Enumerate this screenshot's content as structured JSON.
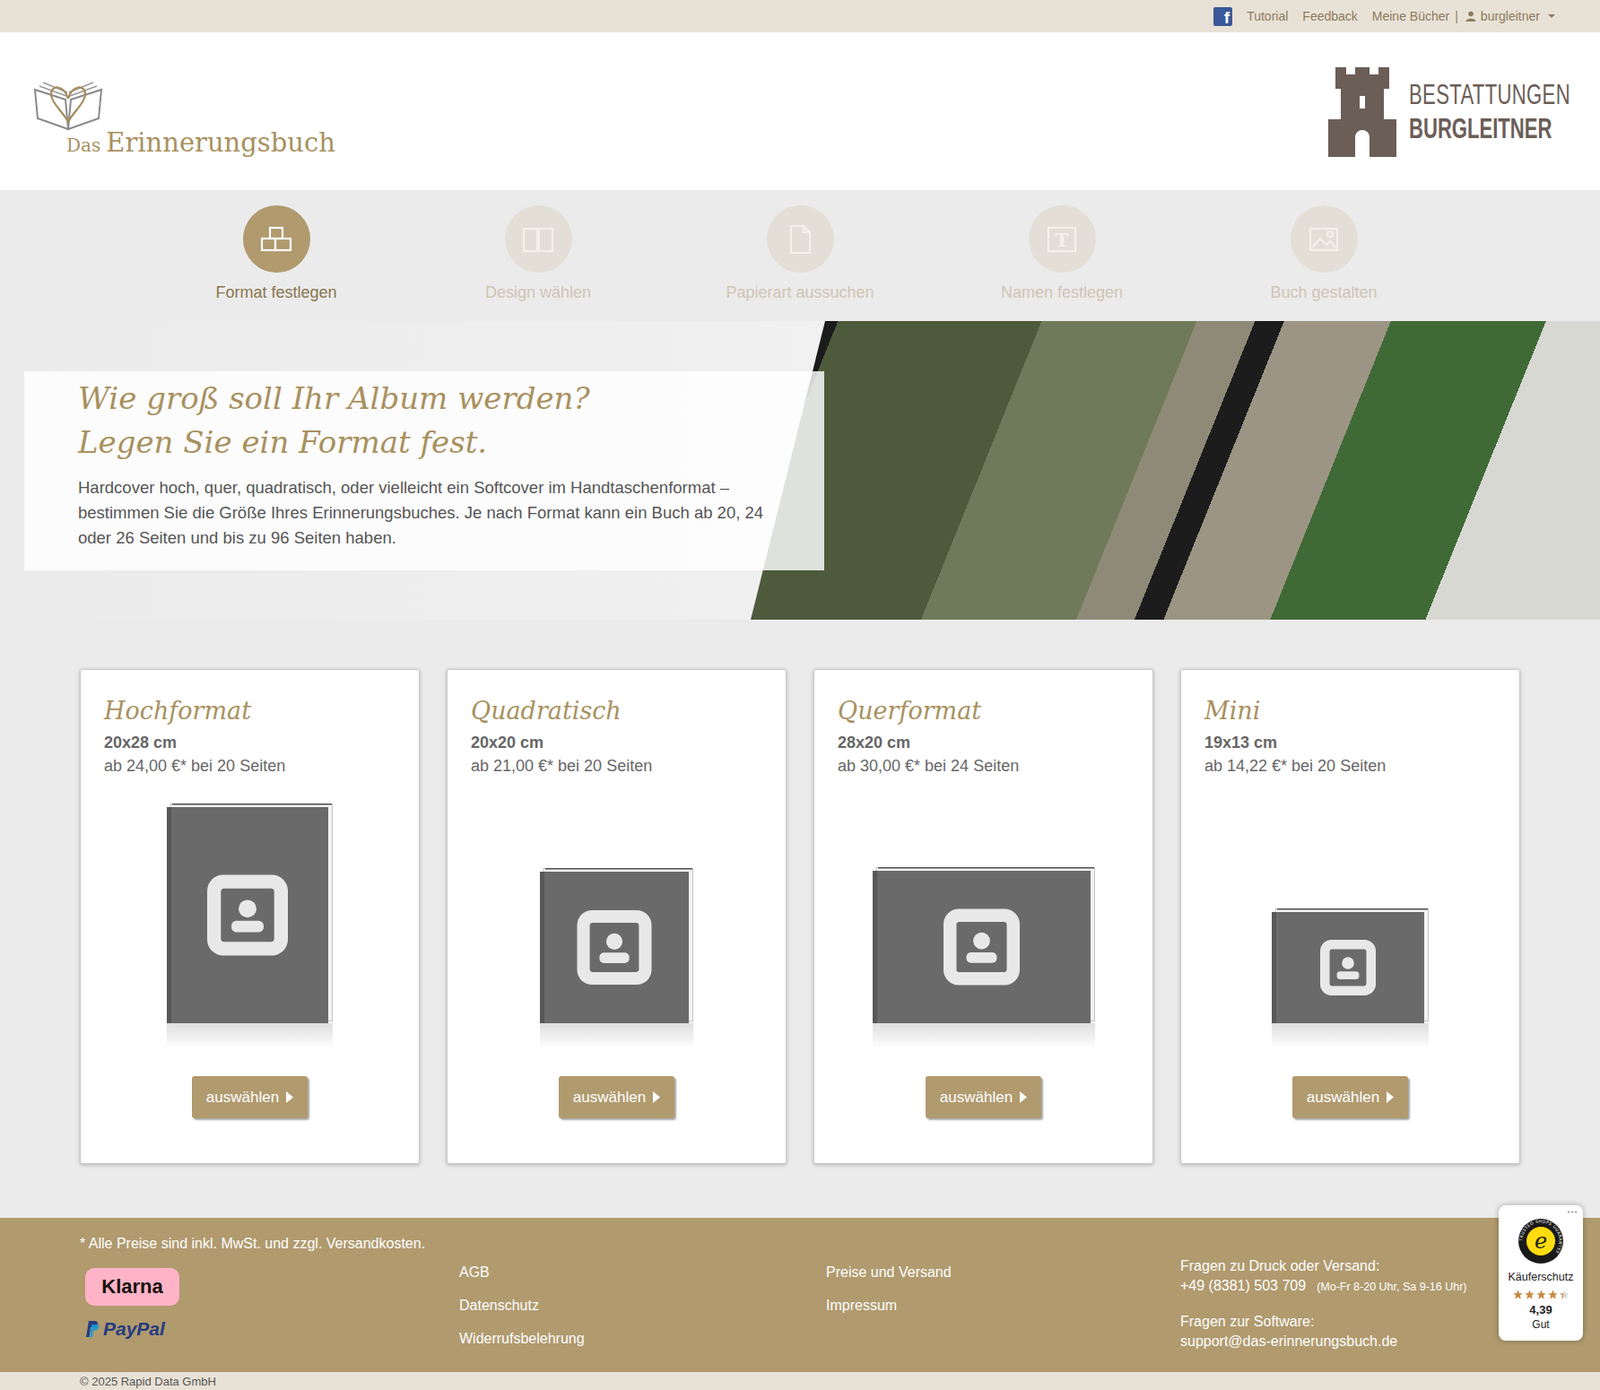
{
  "topbar": {
    "facebook_icon": "f",
    "links": [
      "Tutorial",
      "Feedback",
      "Meine Bücher"
    ],
    "separator": "|",
    "user": "burgleitner"
  },
  "header": {
    "logo": {
      "prefix": "Das",
      "name": "Erinnerungsbuch"
    },
    "partner": {
      "line1": "BESTATTUNGEN",
      "line2": "BURGLEITNER"
    }
  },
  "steps": [
    {
      "label": "Format festlegen",
      "kind": "format",
      "selected": true
    },
    {
      "label": "Design wählen",
      "kind": "design",
      "selected": false
    },
    {
      "label": "Papierart aussuchen",
      "kind": "paper",
      "selected": false
    },
    {
      "label": "Namen festlegen",
      "kind": "name",
      "glyph": "T",
      "selected": false
    },
    {
      "label": "Buch gestalten",
      "kind": "layout",
      "selected": false
    }
  ],
  "hero": {
    "title_lines": [
      "Wie groß soll Ihr Album werden?",
      "Legen Sie ein Format fest."
    ],
    "text": "Hardcover hoch, quer, quadratisch, oder vielleicht ein Softcover im Handtaschenformat – bestimmen Sie die Größe Ihres Erinnerungsbuches. Je nach Format kann ein Buch ab 20, 24 oder 26 Seiten und bis zu 96 Seiten haben."
  },
  "formats": [
    {
      "title": "Hochformat",
      "size": "20x28 cm",
      "price": "ab 24,00 €* bei 20 Seiten",
      "kind": "portrait",
      "button": "auswählen"
    },
    {
      "title": "Quadratisch",
      "size": "20x20 cm",
      "price": "ab 21,00 €* bei 20 Seiten",
      "kind": "square",
      "button": "auswählen"
    },
    {
      "title": "Querformat",
      "size": "28x20 cm",
      "price": "ab 30,00 €* bei 24 Seiten",
      "kind": "landscape",
      "button": "auswählen"
    },
    {
      "title": "Mini",
      "size": "19x13 cm",
      "price": "ab 14,22 €* bei 20 Seiten",
      "kind": "mini",
      "button": "auswählen"
    }
  ],
  "footer": {
    "note": "* Alle Preise sind inkl. MwSt. und zzgl. Versandkosten.",
    "payments": [
      {
        "label": "Klarna",
        "kind": "klarna"
      },
      {
        "label": "PayPal",
        "kind": "paypal"
      }
    ],
    "link_columns": [
      [
        "AGB",
        "Datenschutz",
        "Widerrufsbelehrung"
      ],
      [
        "Preise und Versand",
        "Impressum"
      ]
    ],
    "contact": {
      "print_label": "Fragen zu Druck oder Versand:",
      "phone": "+49 (8381) 503 709",
      "hours": "(Mo-Fr 8-20 Uhr, Sa 9-16 Uhr)",
      "software_label": "Fragen zur Software:",
      "email": "support@das-erinnerungsbuch.de"
    },
    "copyright": "© 2025 Rapid Data GmbH"
  },
  "badge": {
    "more": "···",
    "seal_letter": "e",
    "seal_ring": "TRUSTED SHOPS GUARANTEE",
    "label": "Käuferschutz",
    "stars": 4.39,
    "rating": "4,39",
    "grade": "Gut"
  }
}
